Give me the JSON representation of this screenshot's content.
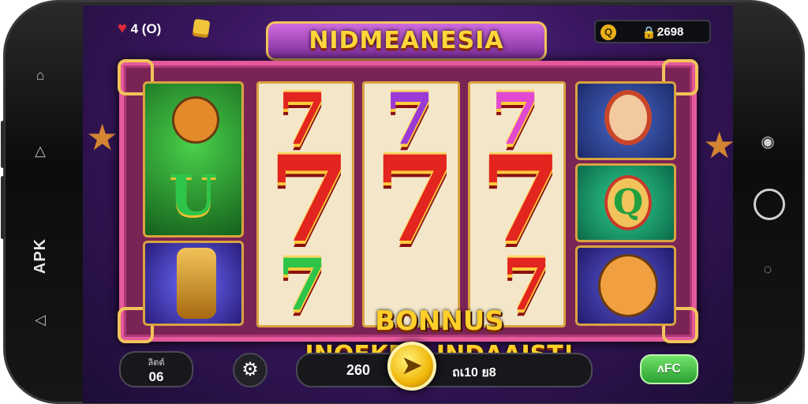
{
  "device": {
    "side_label": "APK"
  },
  "topbar": {
    "lives_text": "4 (O)",
    "balance": "2698",
    "balance_prefix": "🔒:",
    "coin_symbol": "Q"
  },
  "title": "NIDMEANESIA",
  "bonus": {
    "line1": "BONNUS",
    "line2": "INOEKDO INDAAIST!"
  },
  "bottom": {
    "bet_label": "ลิตต์",
    "bet_value": "06",
    "total_value": "260",
    "win_text": "ถเ10 ย8",
    "action_label": "ᴧFC"
  },
  "colors": {
    "accent_pink": "#e45a9c",
    "gold": "#f2c35a",
    "spin_gold": "#f0b70a",
    "action_green": "#2aa032",
    "title_yellow": "#ffd63a"
  },
  "icons": [
    "heart-icon",
    "gem-icon",
    "coin-icon",
    "gear-icon",
    "spin-icon",
    "home-icon",
    "back-icon",
    "camera-icon",
    "recent-apps-icon"
  ]
}
